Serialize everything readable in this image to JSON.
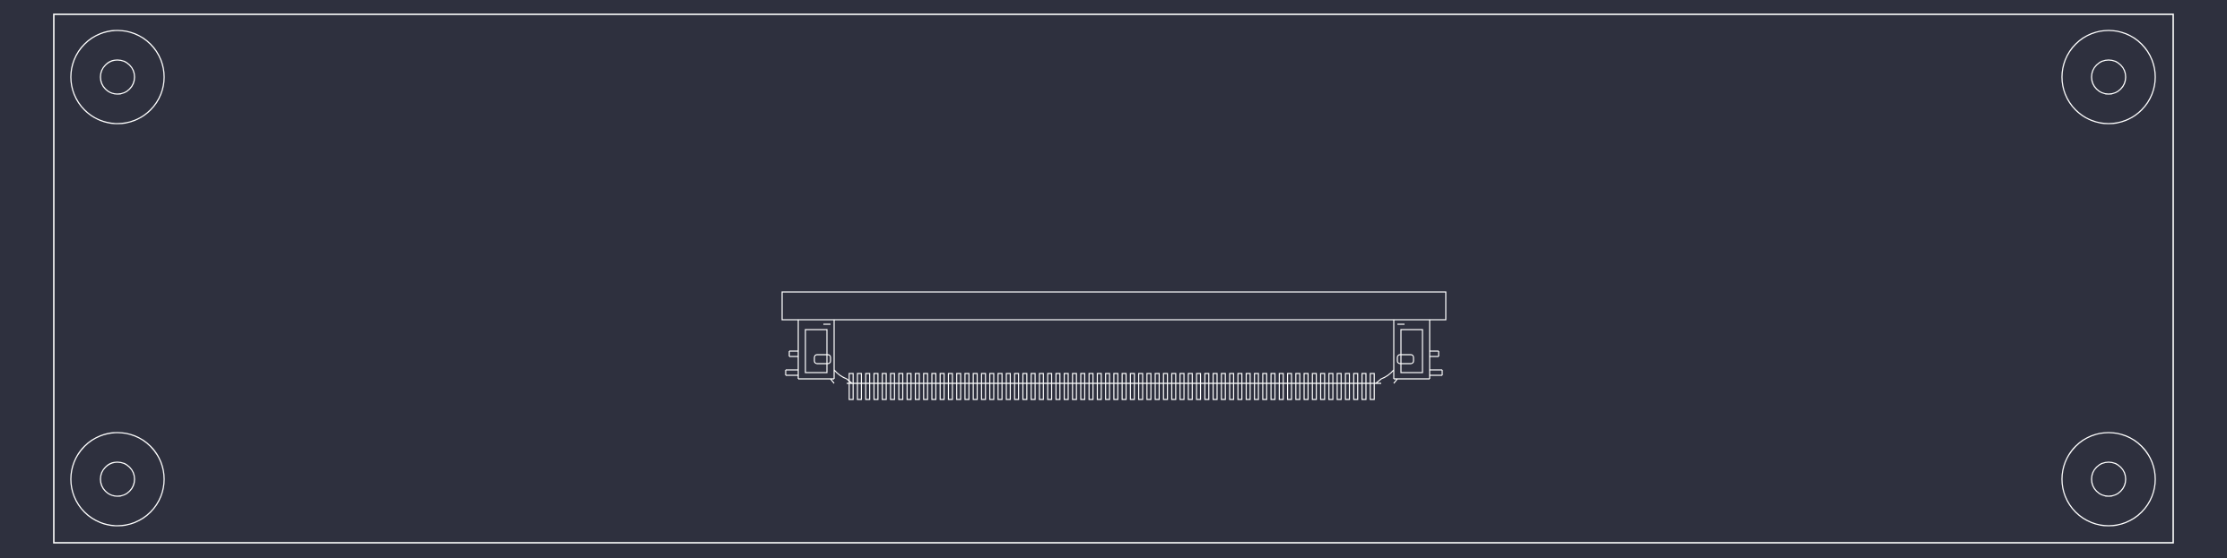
{
  "drawing": {
    "background_color": "#2e303e",
    "line_color": "#ffffff",
    "board_outline": {
      "name": "board-outline"
    },
    "mounting_holes": [
      {
        "id": "top-left"
      },
      {
        "id": "top-right"
      },
      {
        "id": "bottom-left"
      },
      {
        "id": "bottom-right"
      }
    ],
    "connector": {
      "name": "edge-connector",
      "pin_count": 64
    }
  }
}
